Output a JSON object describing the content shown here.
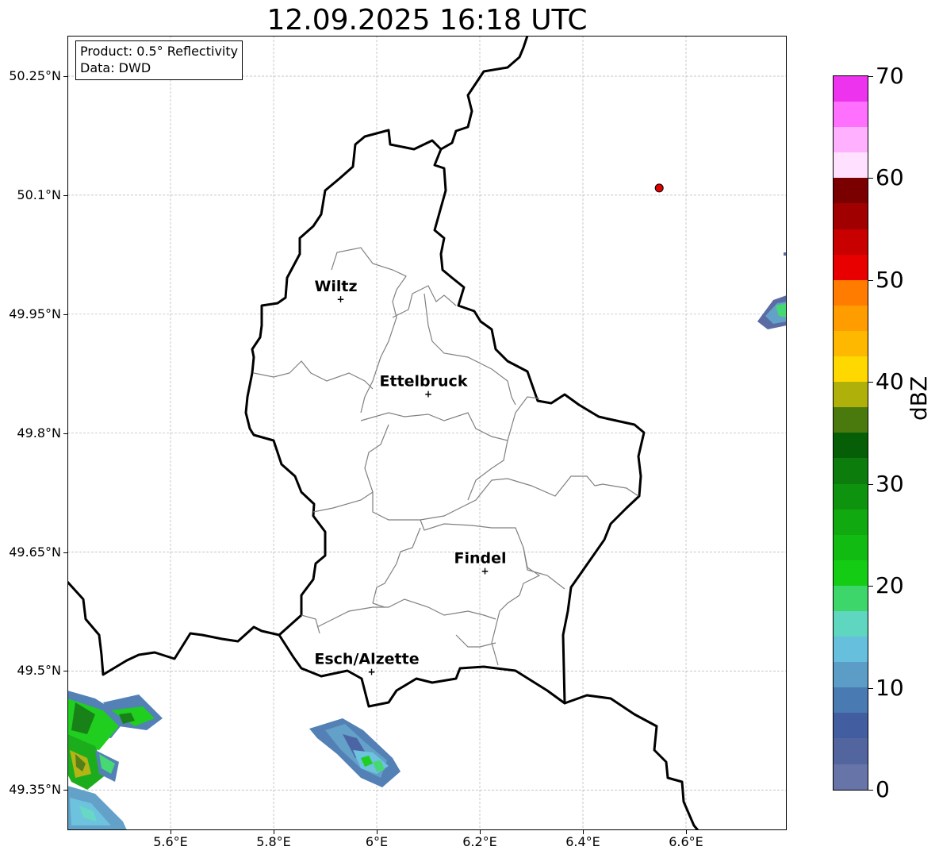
{
  "title": "12.09.2025 16:18 UTC",
  "info": {
    "product": "Product: 0.5° Reflectivity",
    "data": "Data: DWD"
  },
  "axes": {
    "y_ticks": [
      {
        "lat": 50.25,
        "label": "50.25°N"
      },
      {
        "lat": 50.1,
        "label": "50.1°N"
      },
      {
        "lat": 49.95,
        "label": "49.95°N"
      },
      {
        "lat": 49.8,
        "label": "49.8°N"
      },
      {
        "lat": 49.65,
        "label": "49.65°N"
      },
      {
        "lat": 49.5,
        "label": "49.5°N"
      },
      {
        "lat": 49.35,
        "label": "49.35°N"
      }
    ],
    "x_ticks": [
      {
        "lon": 5.6,
        "label": "5.6°E"
      },
      {
        "lon": 5.8,
        "label": "5.8°E"
      },
      {
        "lon": 6.0,
        "label": "6°E"
      },
      {
        "lon": 6.2,
        "label": "6.2°E"
      },
      {
        "lon": 6.4,
        "label": "6.4°E"
      },
      {
        "lon": 6.6,
        "label": "6.6°E"
      }
    ]
  },
  "cities": [
    {
      "name": "Wiltz",
      "lon": 5.93,
      "lat": 49.969
    },
    {
      "name": "Ettelbruck",
      "lon": 6.1,
      "lat": 49.849
    },
    {
      "name": "Findel",
      "lon": 6.21,
      "lat": 49.626
    },
    {
      "name": "Esch/Alzette",
      "lon": 5.99,
      "lat": 49.499
    }
  ],
  "radar_site": {
    "lon": 6.548,
    "lat": 50.109,
    "color": "#e00000"
  },
  "colorbar": {
    "unit": "dBZ",
    "min": 0,
    "max": 70,
    "step": 2.5,
    "tick_labels": [
      "0",
      "10",
      "20",
      "30",
      "40",
      "50",
      "60",
      "70"
    ],
    "colors": [
      "#6674a8",
      "#52659f",
      "#425da0",
      "#4a7ab2",
      "#5b9dc6",
      "#66bfdd",
      "#5fd6c0",
      "#3dd66b",
      "#14cc14",
      "#11bb11",
      "#10a910",
      "#0e930e",
      "#0c7c0c",
      "#065f06",
      "#4a7a0d",
      "#b0b00a",
      "#ffd800",
      "#ffb800",
      "#ff9c00",
      "#ff7c00",
      "#e80000",
      "#c80000",
      "#a00000",
      "#7a0000",
      "#ffe0ff",
      "#ffb0ff",
      "#ff70ff",
      "#ee33ee"
    ]
  },
  "colors": {
    "border": "#000000",
    "cantons": "#808080",
    "grid": "#b4b4b4"
  }
}
